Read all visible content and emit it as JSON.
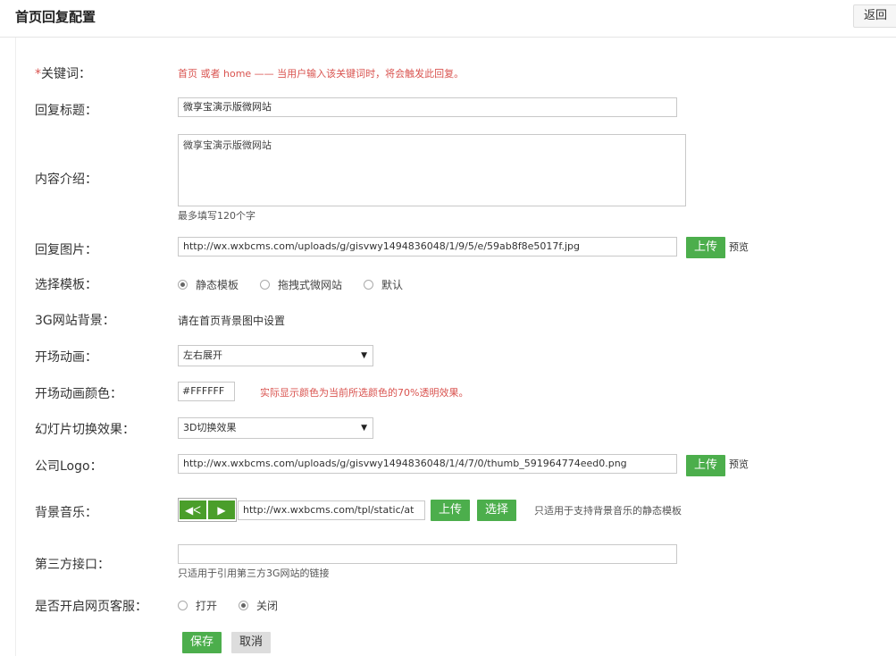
{
  "header": {
    "title": "首页回复配置",
    "back_label": "返回"
  },
  "form": {
    "keyword": {
      "required_mark": "*",
      "label": "关键词：",
      "note": "首页 或者 home —— 当用户输入该关键词时，将会触发此回复。"
    },
    "reply_title": {
      "label": "回复标题：",
      "value": "微享宝演示版微网站"
    },
    "intro": {
      "label": "内容介绍：",
      "value": "微享宝演示版微网站",
      "hint": "最多填写120个字"
    },
    "reply_image": {
      "label": "回复图片：",
      "value": "http://wx.wxbcms.com/uploads/g/gisvwy1494836048/1/9/5/e/59ab8f8e5017f.jpg",
      "upload_label": "上传",
      "preview_label": "预览"
    },
    "template": {
      "label": "选择模板：",
      "options": [
        "静态模板",
        "拖拽式微网站",
        "默认"
      ],
      "selected_index": 0
    },
    "bg_3g": {
      "label": "3G网站背景：",
      "text": "请在首页背景图中设置"
    },
    "opening_anim": {
      "label": "开场动画：",
      "value": "左右展开"
    },
    "anim_color": {
      "label": "开场动画颜色：",
      "value": "#FFFFFF",
      "note": "实际显示颜色为当前所选颜色的70%透明效果。"
    },
    "slide_effect": {
      "label": "幻灯片切换效果：",
      "value": "3D切换效果"
    },
    "logo": {
      "label": "公司Logo：",
      "value": "http://wx.wxbcms.com/uploads/g/gisvwy1494836048/1/4/7/0/thumb_591964774eed0.png",
      "upload_label": "上传",
      "preview_label": "预览"
    },
    "bg_music": {
      "label": "背景音乐：",
      "value": "http://wx.wxbcms.com/tpl/static/at",
      "upload_label": "上传",
      "select_label": "选择",
      "note": "只适用于支持背景音乐的静态模板"
    },
    "third_party": {
      "label": "第三方接口：",
      "value": "",
      "hint": "只适用于引用第三方3G网站的链接"
    },
    "customer_service": {
      "label": "是否开启网页客服：",
      "options": [
        "打开",
        "关闭"
      ],
      "selected_index": 1
    },
    "actions": {
      "save_label": "保存",
      "cancel_label": "取消"
    }
  },
  "colors": {
    "accent_green": "#4cae4c",
    "required_red": "#d9534f"
  },
  "icons": {
    "volume": "volume-icon",
    "play": "play-icon",
    "dropdown": "dropdown-arrow-icon"
  }
}
